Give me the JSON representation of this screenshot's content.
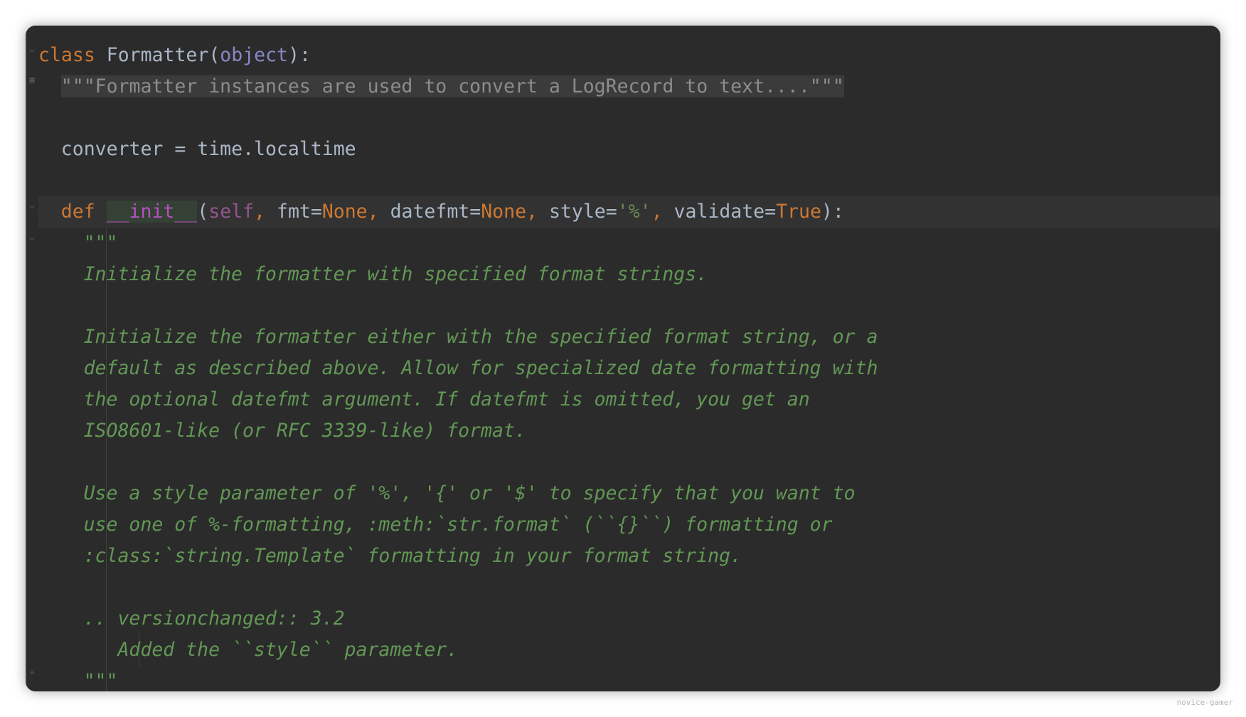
{
  "editor": {
    "lines": [
      {
        "id": "class-line",
        "segments": [
          [
            "class ",
            "kw"
          ],
          [
            "Formatter(",
            "cls"
          ],
          [
            "object",
            "builtin"
          ],
          [
            "):",
            "cls"
          ]
        ]
      },
      {
        "id": "folded-docstring",
        "segments": [
          [
            "\"\"\"Formatter instances are used to convert a LogRecord to text....\"\"\"",
            "docstring-folded"
          ]
        ]
      },
      {
        "id": "blank-1",
        "segments": []
      },
      {
        "id": "converter-line",
        "segments": [
          [
            "converter = time.localtime",
            "cls"
          ]
        ]
      },
      {
        "id": "blank-2",
        "segments": []
      },
      {
        "id": "def-line",
        "segments": [
          [
            "def ",
            "kw"
          ],
          [
            "__init__",
            "magic magic-bg"
          ],
          [
            "(",
            "cls"
          ],
          [
            "self",
            "self"
          ],
          [
            ", ",
            "kw"
          ],
          [
            "fmt=",
            "cls"
          ],
          [
            "None",
            "kw"
          ],
          [
            ", ",
            "kw"
          ],
          [
            "datefmt=",
            "cls"
          ],
          [
            "None",
            "kw"
          ],
          [
            ", ",
            "kw"
          ],
          [
            "style=",
            "cls"
          ],
          [
            "'%'",
            "str"
          ],
          [
            ", ",
            "kw"
          ],
          [
            "validate=",
            "cls"
          ],
          [
            "True",
            "kw"
          ],
          [
            "):",
            "cls"
          ]
        ]
      },
      {
        "id": "doc-open",
        "segments": [
          [
            "\"\"\"",
            "doc"
          ]
        ]
      },
      {
        "id": "doc-1",
        "segments": [
          [
            "Initialize the formatter with specified format strings.",
            "doc"
          ]
        ]
      },
      {
        "id": "doc-blank-1",
        "segments": []
      },
      {
        "id": "doc-2",
        "segments": [
          [
            "Initialize the formatter either with the specified format string, or a",
            "doc"
          ]
        ]
      },
      {
        "id": "doc-3",
        "segments": [
          [
            "default as described above. Allow for specialized date formatting with",
            "doc"
          ]
        ]
      },
      {
        "id": "doc-4",
        "segments": [
          [
            "the optional datefmt argument. If datefmt is omitted, you get an",
            "doc"
          ]
        ]
      },
      {
        "id": "doc-5",
        "segments": [
          [
            "ISO8601-like (or RFC 3339-like) format.",
            "doc"
          ]
        ]
      },
      {
        "id": "doc-blank-2",
        "segments": []
      },
      {
        "id": "doc-6",
        "segments": [
          [
            "Use a style parameter of '%', '{' or '$' to specify that you want to",
            "doc"
          ]
        ]
      },
      {
        "id": "doc-7",
        "segments": [
          [
            "use one of %-formatting, :meth:`str.format` (``{}``) formatting or",
            "doc"
          ]
        ]
      },
      {
        "id": "doc-8",
        "segments": [
          [
            ":class:`string.Template` formatting in your format string.",
            "doc"
          ]
        ]
      },
      {
        "id": "doc-blank-3",
        "segments": []
      },
      {
        "id": "doc-9",
        "segments": [
          [
            ".. versionchanged:: 3.2",
            "doc"
          ]
        ]
      },
      {
        "id": "doc-10",
        "segments": [
          [
            "   Added the ``style`` parameter.",
            "doc"
          ]
        ]
      },
      {
        "id": "doc-close",
        "segments": [
          [
            "\"\"\"",
            "doc"
          ]
        ]
      }
    ],
    "indents": [
      0,
      2,
      0,
      2,
      0,
      2,
      4,
      4,
      0,
      4,
      4,
      4,
      4,
      0,
      4,
      4,
      4,
      0,
      4,
      4,
      4
    ],
    "current_line_index": 5
  },
  "watermark": "novice-gamer"
}
